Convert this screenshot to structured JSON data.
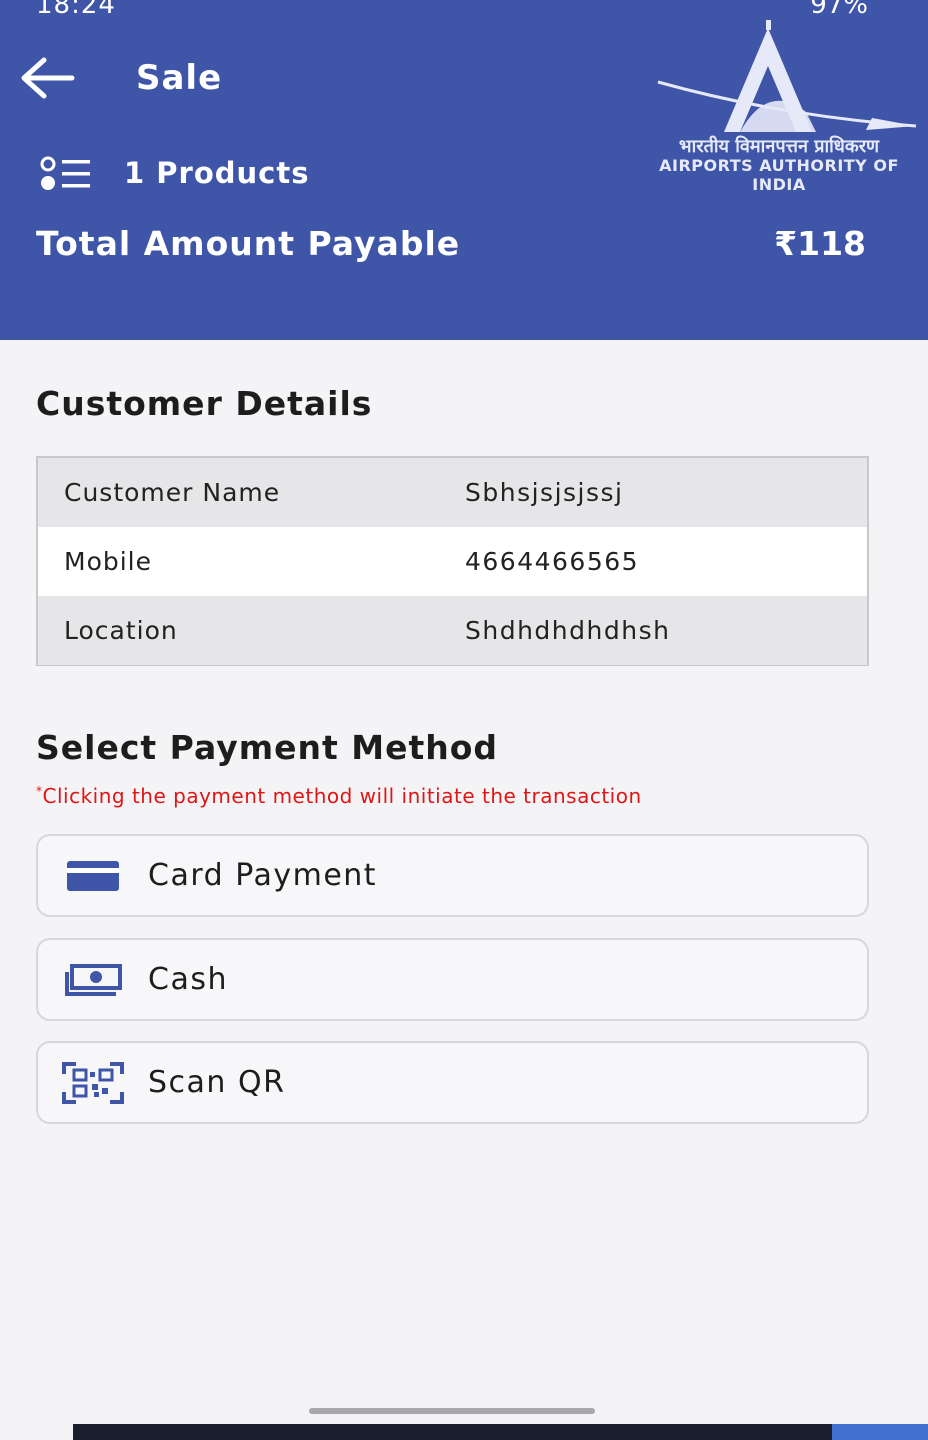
{
  "status_bar": {
    "time": "18:24",
    "battery": "97%"
  },
  "header": {
    "title": "Sale",
    "products": "1 Products",
    "total_label": "Total Amount Payable",
    "total_value": "₹118"
  },
  "logo": {
    "hindi": "भारतीय विमानपत्तन प्राधिकरण",
    "english": "AIRPORTS AUTHORITY OF INDIA"
  },
  "customer": {
    "title": "Customer Details",
    "rows": [
      {
        "label": "Customer Name",
        "value": "Sbhsjsjsjssj"
      },
      {
        "label": "Mobile",
        "value": "4664466565"
      },
      {
        "label": "Location",
        "value": "Shdhdhdhdhsh"
      }
    ]
  },
  "payment": {
    "title": "Select Payment Method",
    "note": "Clicking the payment method will initiate the transaction",
    "methods": [
      {
        "label": "Card Payment",
        "icon": "credit-card-icon"
      },
      {
        "label": "Cash",
        "icon": "cash-icon"
      },
      {
        "label": "Scan QR",
        "icon": "qr-scan-icon"
      }
    ]
  },
  "colors": {
    "primary": "#3f56a8",
    "note": "#e01616"
  }
}
